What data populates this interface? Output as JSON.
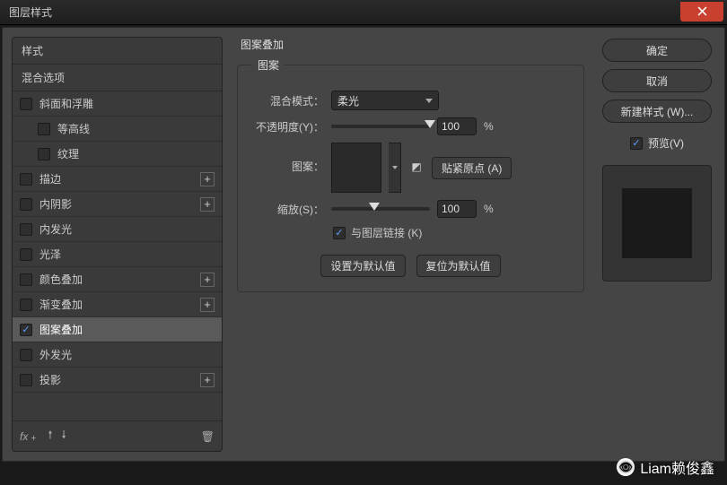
{
  "window": {
    "title": "图层样式"
  },
  "sidebar": {
    "header1": "样式",
    "header2": "混合选项",
    "items": [
      {
        "label": "斜面和浮雕",
        "checked": false,
        "indent": false,
        "plus": false
      },
      {
        "label": "等高线",
        "checked": false,
        "indent": true,
        "plus": false
      },
      {
        "label": "纹理",
        "checked": false,
        "indent": true,
        "plus": false
      },
      {
        "label": "描边",
        "checked": false,
        "indent": false,
        "plus": true
      },
      {
        "label": "内阴影",
        "checked": false,
        "indent": false,
        "plus": true
      },
      {
        "label": "内发光",
        "checked": false,
        "indent": false,
        "plus": false
      },
      {
        "label": "光泽",
        "checked": false,
        "indent": false,
        "plus": false
      },
      {
        "label": "颜色叠加",
        "checked": false,
        "indent": false,
        "plus": true
      },
      {
        "label": "渐变叠加",
        "checked": false,
        "indent": false,
        "plus": true
      },
      {
        "label": "图案叠加",
        "checked": true,
        "indent": false,
        "plus": false,
        "selected": true
      },
      {
        "label": "外发光",
        "checked": false,
        "indent": false,
        "plus": false
      },
      {
        "label": "投影",
        "checked": false,
        "indent": false,
        "plus": true
      }
    ],
    "footer": {
      "fx": "fx",
      "trash": "trash"
    }
  },
  "main": {
    "section_title": "图案叠加",
    "legend": "图案",
    "blend_label": "混合模式：",
    "blend_value": "柔光",
    "opacity_label": "不透明度(Y)：",
    "opacity_value": "100",
    "opacity_unit": "%",
    "pattern_label": "图案：",
    "snap_label": "贴紧原点 (A)",
    "scale_label": "缩放(S)：",
    "scale_value": "100",
    "scale_unit": "%",
    "link_label": "与图层链接 (K)",
    "set_default": "设置为默认值",
    "reset_default": "复位为默认值"
  },
  "right": {
    "ok": "确定",
    "cancel": "取消",
    "new_style": "新建样式 (W)...",
    "preview": "预览(V)"
  },
  "watermark": "Liam赖俊鑫"
}
